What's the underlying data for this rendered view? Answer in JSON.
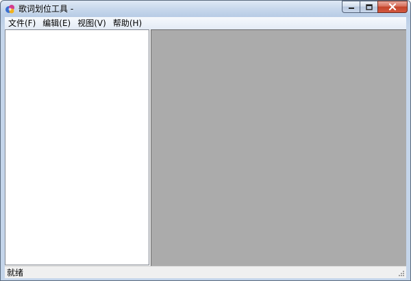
{
  "window": {
    "title": "歌词划位工具 -",
    "icon": "app-logo-icon"
  },
  "caption_buttons": {
    "minimize_icon": "minimize-icon",
    "maximize_icon": "maximize-icon",
    "close_icon": "close-icon"
  },
  "menubar": {
    "items": [
      {
        "label": "文件(F)"
      },
      {
        "label": "编辑(E)"
      },
      {
        "label": "视图(V)"
      },
      {
        "label": "帮助(H)"
      }
    ]
  },
  "statusbar": {
    "text": "就绪"
  },
  "colors": {
    "left_pane_bg": "#ffffff",
    "right_pane_bg": "#ababab",
    "chrome_bg": "#f0f0f0",
    "close_button": "#c4442b"
  }
}
